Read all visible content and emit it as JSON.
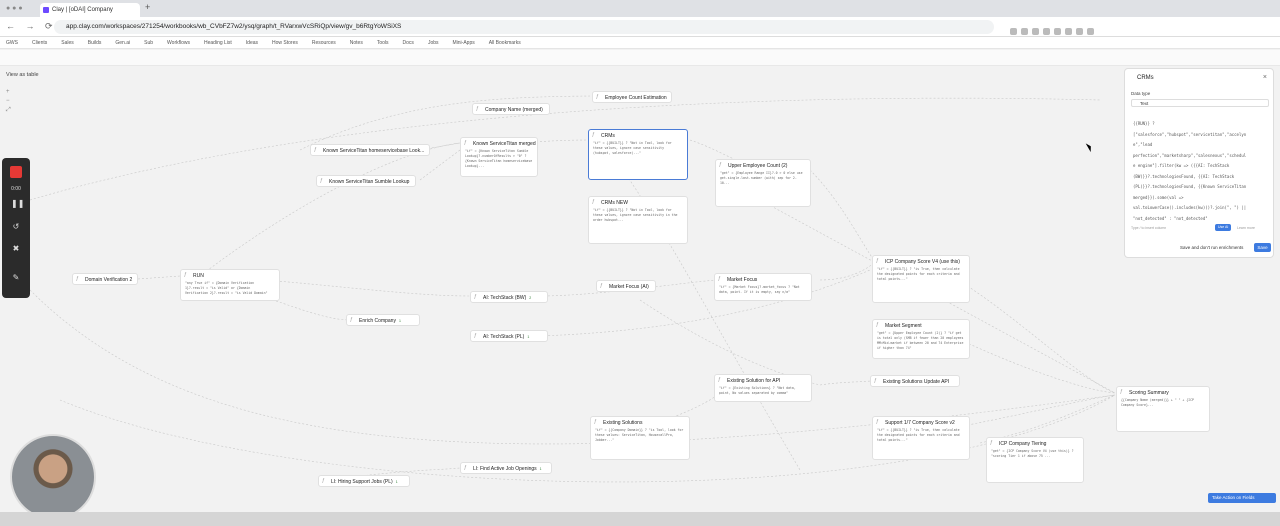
{
  "browser": {
    "tab_title": "Clay | [oDAI] Company",
    "url": "app.clay.com/workspaces/271254/workbooks/wb_CVbFZ7w2/ysq/graph/t_RVarxwVcSRiQp/view/gv_b6RtgYoWSiXS"
  },
  "bookmarks": [
    "GWS",
    "Clients",
    "Sales",
    "Builds",
    "Gen.ai",
    "Sub",
    "Workflows",
    "Heading List",
    "Ideas",
    "How Stores",
    "Resources",
    "Notes",
    "Tools",
    "Docs",
    "Jobs",
    "Mini-Apps",
    "All Bookmarks"
  ],
  "canvas": {
    "view_as_table": "View as table"
  },
  "recorder": {
    "time": "0:00"
  },
  "nodes": [
    {
      "id": "company_name",
      "title": "Company Name (merged)",
      "body": ""
    },
    {
      "id": "employee_count_est",
      "title": "Employee Count Estimation",
      "body": ""
    },
    {
      "id": "known_servicetitan_lookup",
      "title": "Known ServiceTitan homeservicebase Look...",
      "body": ""
    },
    {
      "id": "known_servicetitan_sumble",
      "title": "Known ServiceTitan Sumble Lookup",
      "body": ""
    },
    {
      "id": "known_st_merged",
      "title": "Known ServiceTitan merged",
      "body": "\"if\" = {Known ServiceTitan Sumble Lookup}?.numberOfResults > \"0\" ? {Known ServiceTitan homeservicebase Lookup}..."
    },
    {
      "id": "crms",
      "title": "CRMs",
      "body": "\"if\" = {{BUILT}} ? \"Not in Tool, look for these values, ignore case sensitivity (hubspot, salesforce)...\""
    },
    {
      "id": "upper_emp",
      "title": "Upper Employee Count (2)",
      "body": "\"get\" = {Employee Range II}?.0 > 0 else use get.single.last.number (with) sep for 2-10..."
    },
    {
      "id": "crms_new",
      "title": "CRMs NEW",
      "body": "\"if\" = {{BUILT}} ? \"Not in Tool, look for these values, ignore case sensitivity in the order hubspot..."
    },
    {
      "id": "market_focus_ai",
      "title": "Market Focus (AI)",
      "body": ""
    },
    {
      "id": "market_focus",
      "title": "Market Focus",
      "body": "\"if\" = {Market Focus}?.market_focus ? \"Not data, point. If it is empty, say n/a\""
    },
    {
      "id": "domain_verification",
      "title": "Domain Verification 2",
      "body": ""
    },
    {
      "id": "run",
      "title": "RUN",
      "body": "\"any True if\" = {Domain Verification 1}?.result = \"is Valid\" or {Domain Verification 2}?.result = \"is Valid Domain\""
    },
    {
      "id": "ai_techstack_bw",
      "title": "AI: TechStack (BW)",
      "badge": "2"
    },
    {
      "id": "ai_techstack_pl",
      "title": "AI: TechStack (PL)",
      "badge": "1"
    },
    {
      "id": "enrich_company",
      "title": "Enrich Company",
      "badge": "1"
    },
    {
      "id": "icp_score",
      "title": "ICP Company Score V4 (use this)",
      "body": "\"if\" = {{BUILT}} ? \"is True, then calculate the designated points for each criteria and total points...\""
    },
    {
      "id": "market_segment",
      "title": "Market Segment",
      "body": "\"get\" = {Upper Employee Count (2)} ? \"if get is total only (SMB if fewer than 20 employees MM=Mid-market if between 20 and 74 Enterprise if higher than 74\""
    },
    {
      "id": "existing_solution_api",
      "title": "Existing Solution for API",
      "body": "\"if\" = {Existing Solutions} ? \"Not data, point, No values separated by comma\""
    },
    {
      "id": "existing_solutions_update",
      "title": "Existing Solutions Update API",
      "body": ""
    },
    {
      "id": "existing_solutions",
      "title": "Existing Solutions",
      "body": "\"if\" = {{Company Domain}} ? \"is Tool, look for these values: ServiceTitan, HousecallPro, Jobber...\""
    },
    {
      "id": "support_score",
      "title": "Support 1/7 Company Score v2",
      "body": "\"if\" = {{BUILT}} ? \"is True, then calculate the designated points for each criteria and total points...\""
    },
    {
      "id": "scoring_summary",
      "title": "Scoring Summary",
      "body": "{{Company Name (merged)}} + \" \" + {ICP Company Score}..."
    },
    {
      "id": "company_tiering",
      "title": "ICP Company Tiering",
      "body": "\"get\" = {ICP Company Score V4 (use this)} ? \"scoring Tier 1 if above 75 ..."
    },
    {
      "id": "hiring_support",
      "title": "LI: Hiring Support Jobs (PL)",
      "badge": "1"
    },
    {
      "id": "find_active_jobs",
      "title": "LI: Find Active Job Openings",
      "badge": "1"
    }
  ],
  "side_panel": {
    "title": "CRMs",
    "data_type_label": "Data type",
    "data_type_value": "Text",
    "code_lines": [
      "{{RUN}} ?",
      "[\"salesforce\",\"hubspot\",\"servicetitan\",\"accelyn",
      "e\",\"lead",
      "perfection\",\"marketsharp\",\"salesnexus\",\"schedul",
      "e engine\"].filter(kw => ({{AI: TechStack",
      "(BW)}}?.technologiesFound, {{AI: TechStack",
      "(PL)}}?.technologiesFound, {{Known ServiceTitan",
      "merged}}).some(val =>",
      "val.toLowerCase().includes(kw)))?.join(\", \") ||",
      "\"not_detected\" : \"not_detected\""
    ],
    "hint": "Type / to insert column",
    "use_ai": "Use AI",
    "learn_more": "Learn more",
    "save_dont_run": "Save and don't run enrichments",
    "save": "Save"
  },
  "action_button": "Take Action on Fields"
}
